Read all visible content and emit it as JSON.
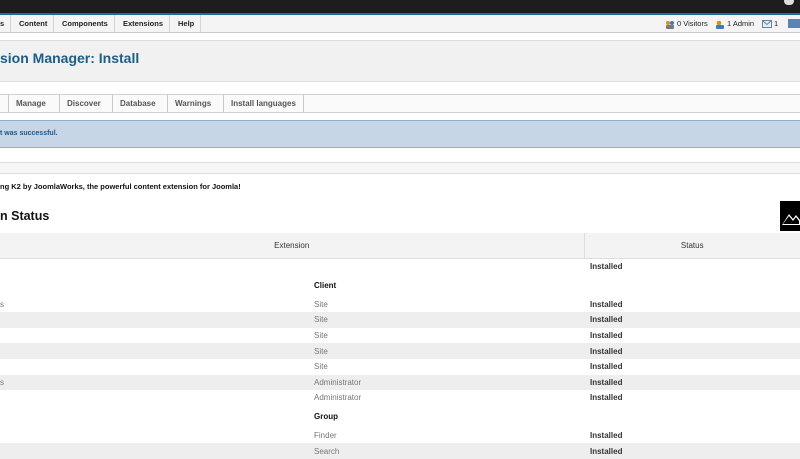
{
  "topbar": {},
  "menu": {
    "items": [
      "s",
      "Content",
      "Components",
      "Extensions",
      "Help"
    ]
  },
  "status": {
    "visitors": "0 Visitors",
    "admin": "1 Admin",
    "messages": "1"
  },
  "page": {
    "title": "sion Manager: Install"
  },
  "subnav": {
    "items": [
      "Manage",
      "Discover",
      "Database",
      "Warnings",
      "Install languages"
    ]
  },
  "message": {
    "text": "t was successful."
  },
  "welcome": {
    "text": "ng K2 by JoomlaWorks, the powerful content extension for Joomla!"
  },
  "section": {
    "title": "n Status"
  },
  "table": {
    "headers": {
      "extension": "Extension",
      "status": "Status"
    },
    "rows": [
      {
        "kind": "data",
        "left": "",
        "mid": "",
        "status": "Installed"
      },
      {
        "kind": "group",
        "label": "Client"
      },
      {
        "kind": "data",
        "left": "s",
        "mid": "Site",
        "status": "Installed"
      },
      {
        "kind": "data",
        "left": "",
        "mid": "Site",
        "status": "Installed"
      },
      {
        "kind": "data",
        "left": "",
        "mid": "Site",
        "status": "Installed"
      },
      {
        "kind": "data",
        "left": "",
        "mid": "Site",
        "status": "Installed"
      },
      {
        "kind": "data",
        "left": "",
        "mid": "Site",
        "status": "Installed"
      },
      {
        "kind": "data",
        "left": "s",
        "mid": "Administrator",
        "status": "Installed"
      },
      {
        "kind": "data",
        "left": "",
        "mid": "Administrator",
        "status": "Installed"
      },
      {
        "kind": "group",
        "label": "Group"
      },
      {
        "kind": "data",
        "left": "",
        "mid": "Finder",
        "status": "Installed"
      },
      {
        "kind": "data",
        "left": "",
        "mid": "Search",
        "status": "Installed"
      }
    ]
  },
  "colors": {
    "brand_blue": "#1c5d87",
    "message_bg": "#c6d6e6"
  },
  "icons": {
    "visitors": "users-icon",
    "admin": "admin-user-icon",
    "messages": "mail-icon",
    "k2": "k2-logo"
  }
}
